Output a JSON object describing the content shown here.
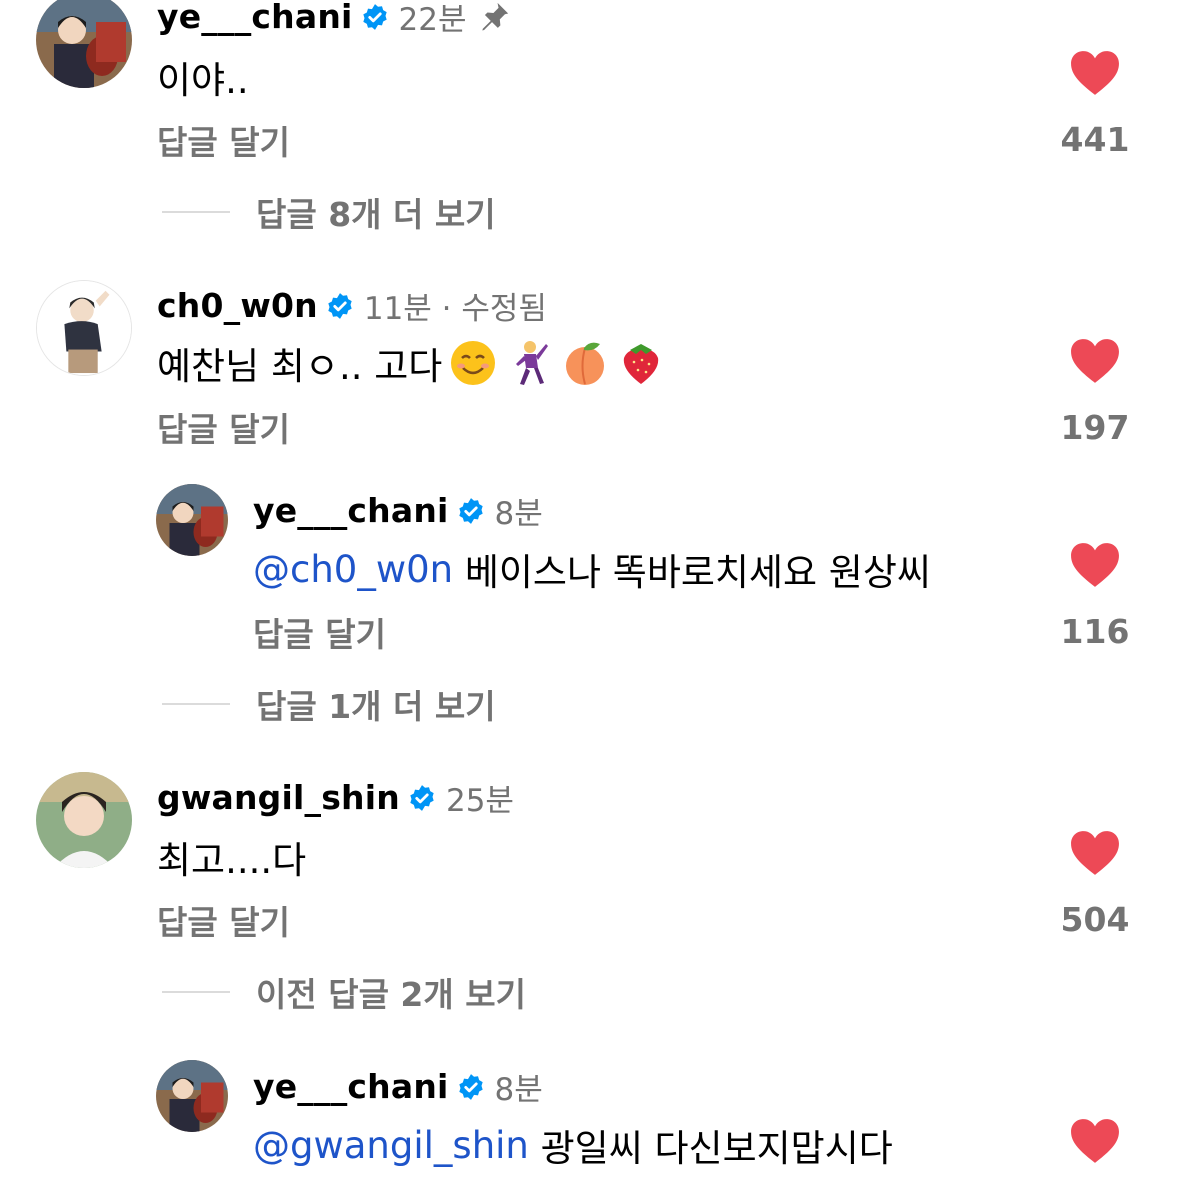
{
  "comments": [
    {
      "username": "ye___chani",
      "time": "22분",
      "text": "이야..",
      "reply_label": "답글 달기",
      "likes": "441",
      "more_replies": "답글 8개 더 보기"
    },
    {
      "username": "ch0_w0n",
      "time": "11분 · 수정됨",
      "text": "예찬님 최ㅇ.. 고다",
      "reply_label": "답글 달기",
      "likes": "197"
    },
    {
      "username": "ye___chani",
      "time": "8분",
      "mention": "@ch0_w0n",
      "text": " 베이스나 똑바로치세요 원상씨",
      "reply_label": "답글 달기",
      "likes": "116",
      "more_replies": "답글 1개 더 보기"
    },
    {
      "username": "gwangil_shin",
      "time": "25분",
      "text": "최고....다",
      "reply_label": "답글 달기",
      "likes": "504",
      "more_replies": "이전 답글 2개 보기"
    },
    {
      "username": "ye___chani",
      "time": "8분",
      "mention": "@gwangil_shin",
      "text": " 광일씨 다신보지맙시다"
    }
  ],
  "colors": {
    "heart": "#ed4956",
    "verified": "#0095f6",
    "mention": "#1e54c9",
    "secondary_text": "#737373"
  }
}
